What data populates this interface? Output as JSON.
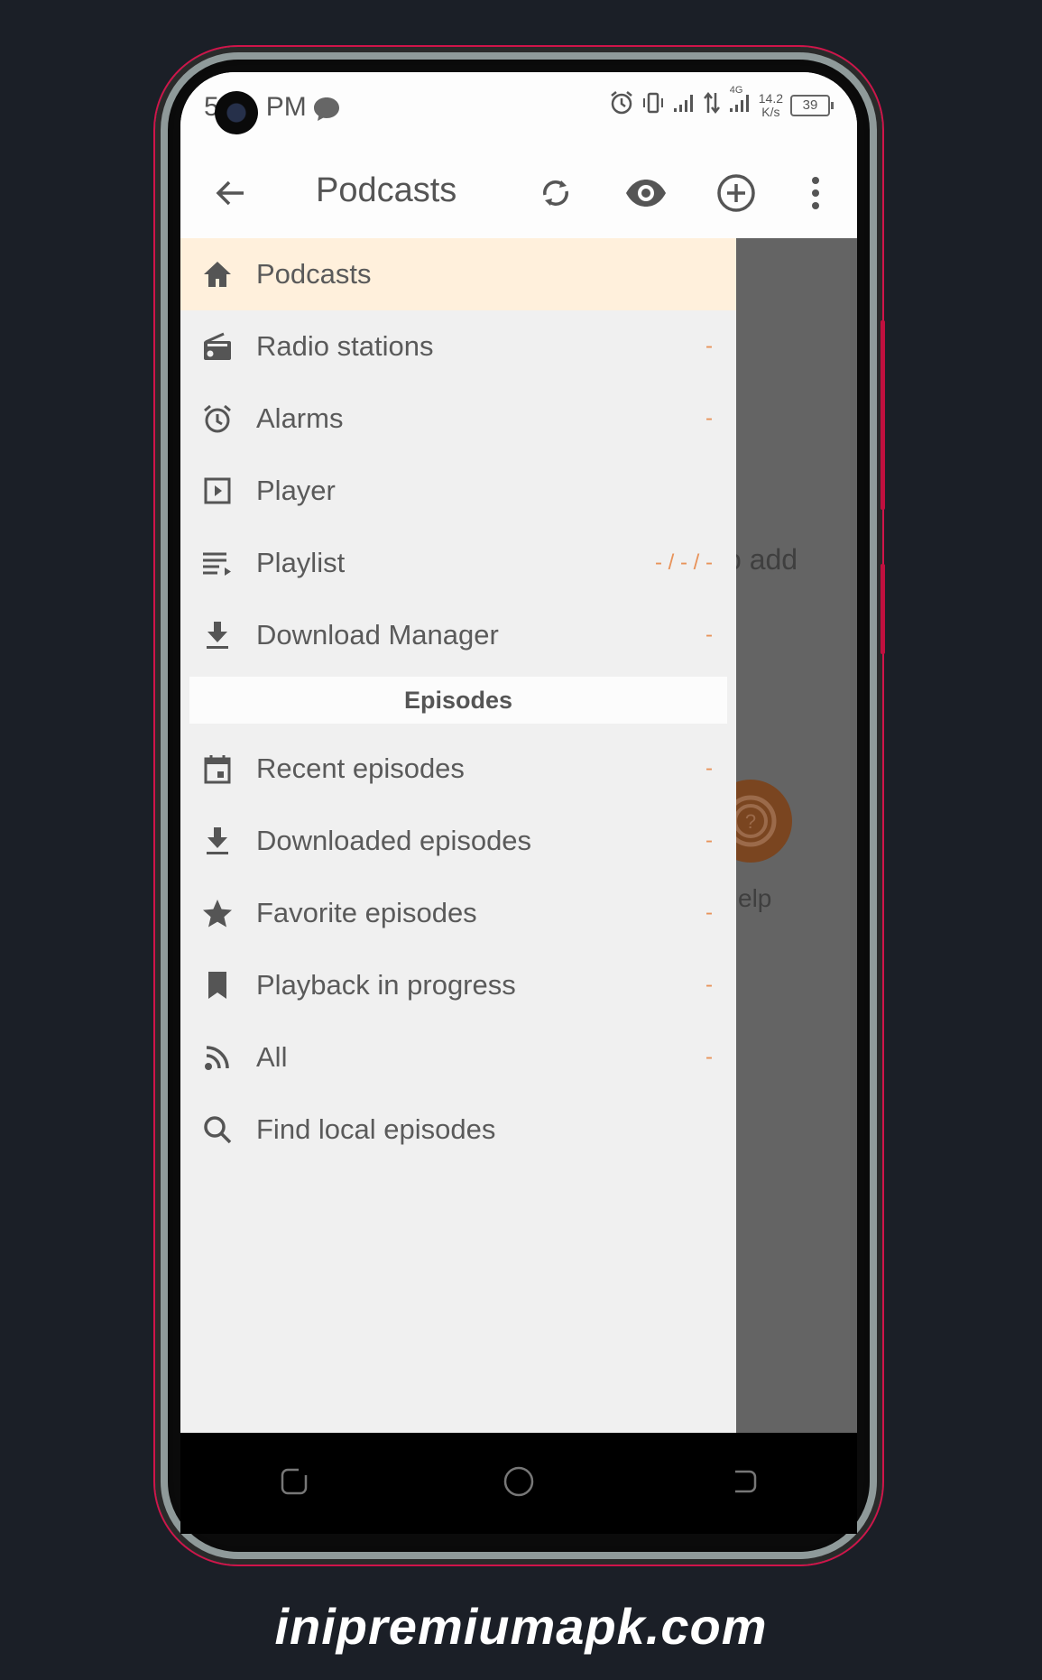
{
  "status_bar": {
    "time_prefix": "5",
    "time_suffix": "PM",
    "network_type": "4G",
    "net_speed_value": "14.2",
    "net_speed_unit": "K/s",
    "battery_level": "39"
  },
  "toolbar": {
    "title": "Podcasts",
    "icons": [
      "back-arrow-icon",
      "refresh-icon",
      "eye-icon",
      "add-circle-icon",
      "more-vert-icon"
    ]
  },
  "drawer": {
    "items": [
      {
        "label": "Podcasts",
        "icon": "home-icon",
        "count": "",
        "active": true
      },
      {
        "label": "Radio stations",
        "icon": "radio-icon",
        "count": "-"
      },
      {
        "label": "Alarms",
        "icon": "alarm-icon",
        "count": "-"
      },
      {
        "label": "Player",
        "icon": "player-icon",
        "count": ""
      },
      {
        "label": "Playlist",
        "icon": "playlist-icon",
        "count": "- / - / -"
      },
      {
        "label": "Download Manager",
        "icon": "download-icon",
        "count": "-"
      }
    ],
    "section_header": "Episodes",
    "episode_items": [
      {
        "label": "Recent episodes",
        "icon": "calendar-icon",
        "count": "-"
      },
      {
        "label": "Downloaded episodes",
        "icon": "download-icon",
        "count": "-"
      },
      {
        "label": "Favorite episodes",
        "icon": "star-icon",
        "count": "-"
      },
      {
        "label": "Playback in progress",
        "icon": "bookmark-icon",
        "count": "-"
      },
      {
        "label": "All",
        "icon": "rss-icon",
        "count": "-"
      },
      {
        "label": "Find local episodes",
        "icon": "search-icon",
        "count": ""
      }
    ],
    "bottom_actions": [
      "refresh-icon",
      "add-circle-icon",
      "settings-icon"
    ]
  },
  "background": {
    "partial_text": "o add",
    "help_label_partial": "elp"
  },
  "watermark": "inipremiumapk.com",
  "colors": {
    "active_item_bg": "#fff0dc",
    "count_accent": "#e8935a",
    "help_button": "#7a4520",
    "phone_accent": "#d0144a"
  }
}
